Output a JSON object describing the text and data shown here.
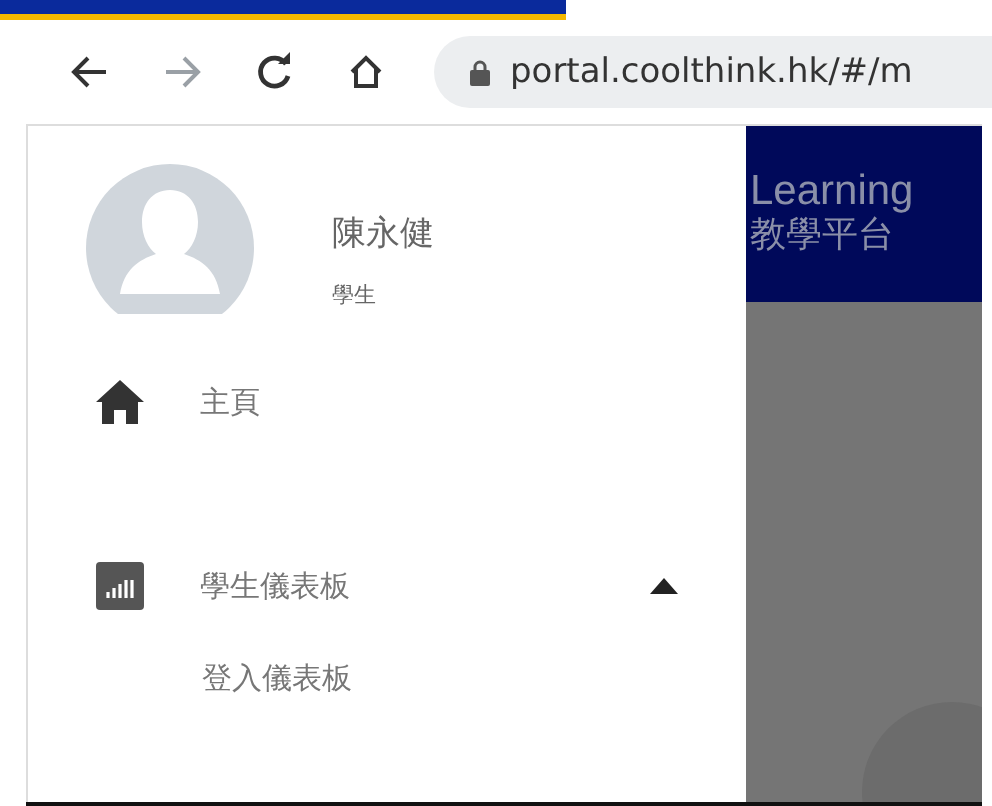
{
  "browser": {
    "url": "portal.coolthink.hk/#/m"
  },
  "profile": {
    "name": "陳永健",
    "role": "學生"
  },
  "banner": {
    "line_1": "Learning",
    "line_2": "教學平台"
  },
  "nav_items": [
    {
      "kind": "home",
      "label": "主頁"
    },
    {
      "kind": "group",
      "label": "學生儀表板",
      "expanded": true,
      "children": [
        {
          "label": "登入儀表板"
        }
      ]
    }
  ]
}
